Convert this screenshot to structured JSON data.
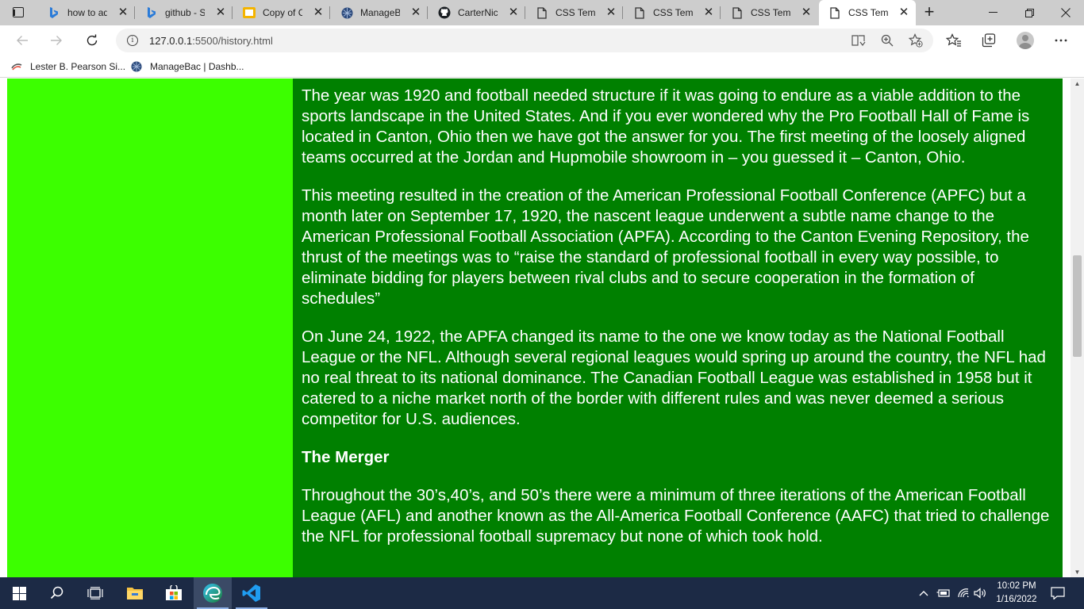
{
  "browser": {
    "tabs": [
      {
        "title": "how to add",
        "icon": "bing-icon",
        "active": false
      },
      {
        "title": "github - Se",
        "icon": "bing-icon",
        "active": false
      },
      {
        "title": "Copy of Cr",
        "icon": "slides-icon",
        "active": false
      },
      {
        "title": "ManageBac",
        "icon": "managebac-icon",
        "active": false
      },
      {
        "title": "CarterNick",
        "icon": "github-icon",
        "active": false
      },
      {
        "title": "CSS Templ",
        "icon": "page-icon",
        "active": false
      },
      {
        "title": "CSS Templ",
        "icon": "page-icon",
        "active": false
      },
      {
        "title": "CSS Templ",
        "icon": "page-icon",
        "active": false
      },
      {
        "title": "CSS Templ",
        "icon": "page-icon",
        "active": true
      }
    ],
    "address": {
      "host": "127.0.0.1",
      "path": ":5500/history.html"
    },
    "favorites": [
      {
        "label": "Lester B. Pearson Si...",
        "icon": "pearson-icon"
      },
      {
        "label": "ManageBac | Dashb...",
        "icon": "managebac-icon"
      }
    ]
  },
  "page": {
    "paragraphs": [
      "The year was 1920 and football needed structure if it was going to endure as a viable addition to the sports landscape in the United States. And if you ever wondered why the Pro Football Hall of Fame is located in Canton, Ohio then we have got the answer for you. The first meeting of the loosely aligned teams occurred at the Jordan and Hupmobile showroom in – you guessed it – Canton, Ohio.",
      "This meeting resulted in the creation of the American Professional Football Conference (APFC) but a month later on September 17, 1920, the nascent league underwent a subtle name change to the American Professional Football Association (APFA). According to the Canton Evening Repository, the thrust of the meetings was to “raise the standard of professional football in every way possible, to eliminate bidding for players between rival clubs and to secure cooperation in the formation of schedules”",
      "On June 24, 1922, the APFA changed its name to the one we know today as the National Football League or the NFL. Although several regional leagues would spring up around the country, the NFL had no real threat to its national dominance. The Canadian Football League was established in 1958 but it catered to a niche market north of the border with different rules and was never deemed a serious competitor for U.S. audiences."
    ],
    "heading": "The Merger",
    "after_heading": "Throughout the 30’s,40’s, and 50’s there were a minimum of three iterations of the American Football League (AFL) and another known as the All-America Football Conference (AAFC) that tried to challenge the NFL for professional football supremacy but none of which took hold.",
    "colors": {
      "sidebar": "#3cff00",
      "content": "#008000",
      "text": "#ffffff"
    }
  },
  "taskbar": {
    "time": "10:02 PM",
    "date": "1/16/2022"
  }
}
